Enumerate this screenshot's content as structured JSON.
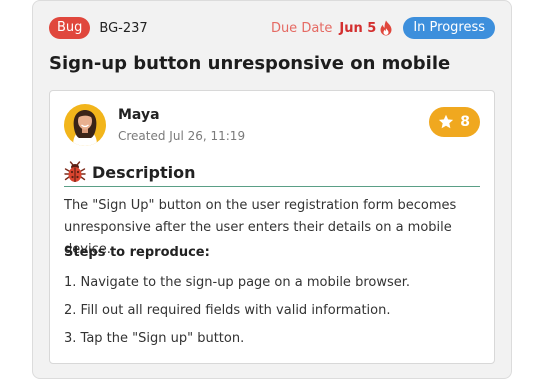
{
  "ticket": {
    "type_label": "Bug",
    "id": "BG-237",
    "due_label": "Due Date",
    "due_date": "Jun 5",
    "status": "In Progress",
    "title": "Sign-up button unresponsive on mobile"
  },
  "author": {
    "name": "Maya",
    "created": "Created Jul 26, 11:19"
  },
  "rating": {
    "count": "8"
  },
  "description": {
    "heading": "Description",
    "body": "The \"Sign Up\" button on the user registration form becomes unresponsive after the user enters their details on a mobile device.",
    "steps_label": "Steps to reproduce:",
    "steps": [
      "1. Navigate to the sign-up page on a mobile browser.",
      "2. Fill out all required fields with valid information.",
      "3. Tap the \"Sign up\" button."
    ]
  },
  "icons": {
    "due": "fire-icon",
    "rating": "star-icon",
    "description": "bug-icon"
  },
  "colors": {
    "bug_badge": "#e0473d",
    "status_badge": "#3d8fdc",
    "due_date": "#d32f2f",
    "rating_badge": "#f0a81f",
    "divider": "#5a9f86"
  }
}
